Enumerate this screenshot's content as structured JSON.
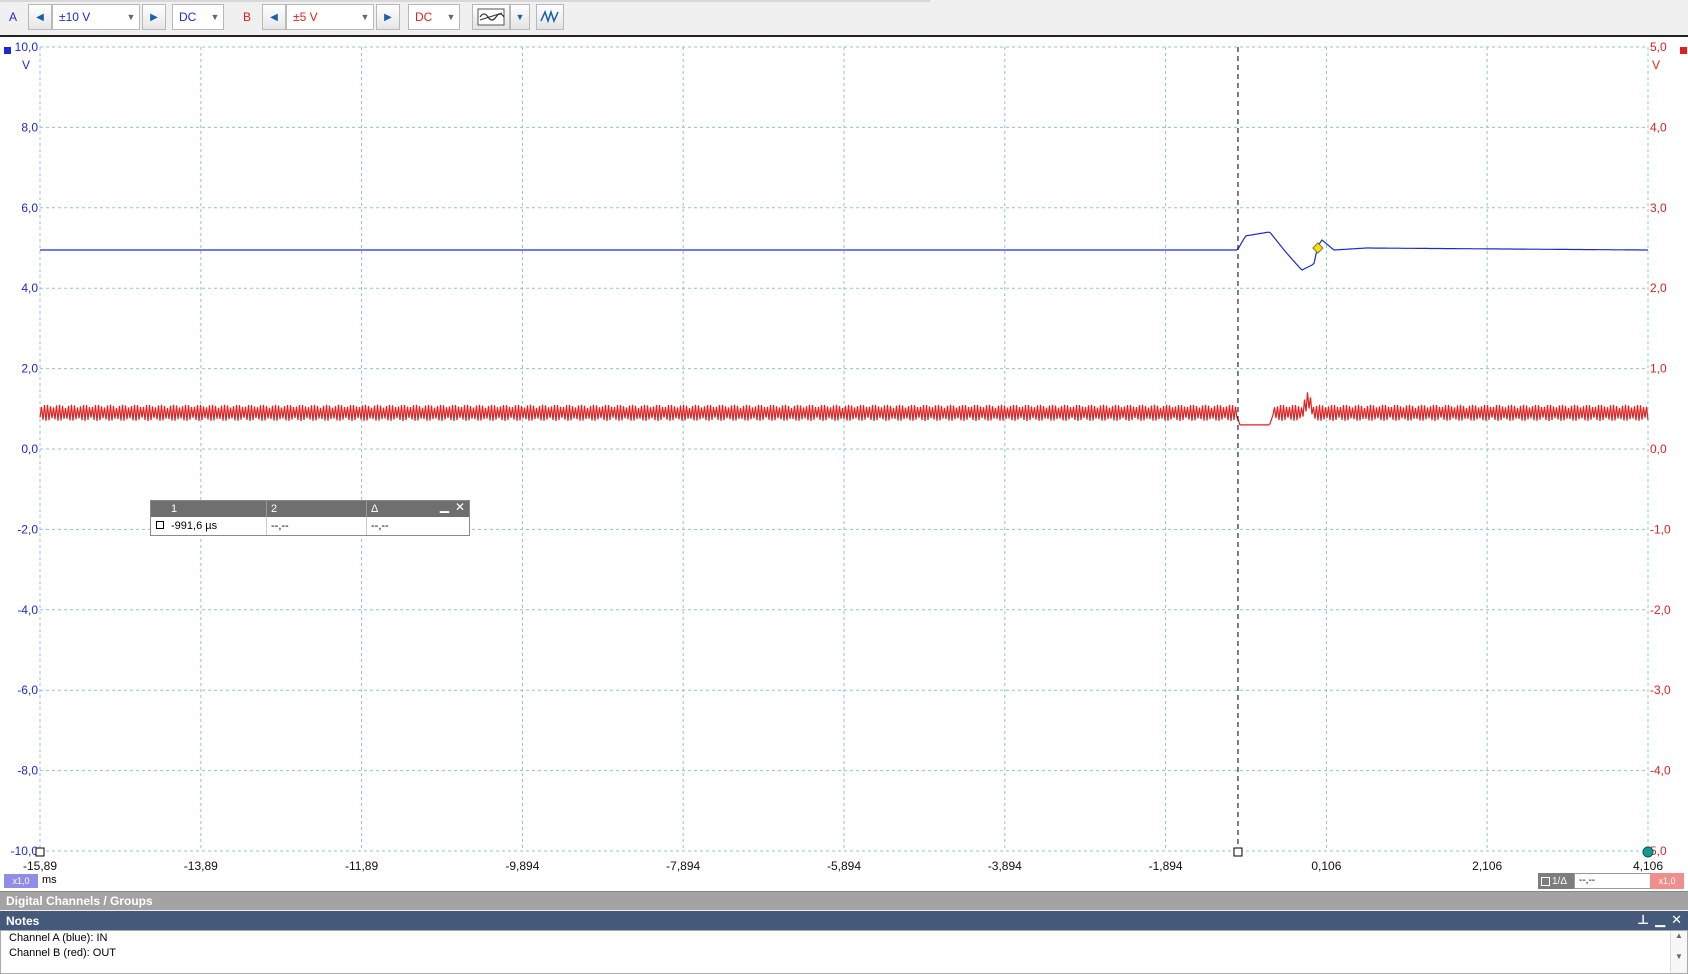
{
  "toolbar": {
    "channel_a": {
      "letter": "A",
      "range": "±10 V",
      "coupling": "DC",
      "color": "#1d2ad4"
    },
    "channel_b": {
      "letter": "B",
      "range": "±5 V",
      "coupling": "DC",
      "color": "#e01f1f"
    }
  },
  "chart_data": {
    "type": "line",
    "x_unit": "ms",
    "x_ticks": [
      "-15,89",
      "-13,89",
      "-11,89",
      "-9,894",
      "-7,894",
      "-5,894",
      "-3,894",
      "-1,894",
      "0,106",
      "2,106",
      "4,106"
    ],
    "xlim": [
      -15.894,
      4.106
    ],
    "y_left": {
      "unit": "V",
      "ticks": [
        "10,0",
        "8,0",
        "6,0",
        "4,0",
        "2,0",
        "0,0",
        "-2,0",
        "-4,0",
        "-6,0",
        "-8,0",
        "-10,0"
      ],
      "ylim": [
        -10,
        10
      ]
    },
    "y_right": {
      "unit": "V",
      "ticks": [
        "5,0",
        "4,0",
        "3,0",
        "2,0",
        "1,0",
        "0,0",
        "-1,0",
        "-2,0",
        "-3,0",
        "-4,0",
        "5,0"
      ],
      "ylim": [
        -5,
        5
      ]
    },
    "grid": true,
    "trigger_time_ms": -0.994,
    "series": [
      {
        "name": "A",
        "color": "#1d2ad4",
        "axis": "left",
        "x": [
          -15.894,
          -1.0,
          -0.9,
          -0.6,
          -0.4,
          -0.2,
          -0.05,
          0.0,
          0.05,
          0.2,
          0.6,
          4.106
        ],
        "y": [
          4.95,
          4.95,
          5.3,
          5.4,
          4.9,
          4.45,
          4.6,
          5.05,
          5.2,
          4.95,
          5.0,
          4.95
        ]
      },
      {
        "name": "B",
        "color": "#e01f1f",
        "axis": "left",
        "x": [
          -15.894,
          -1.0,
          -0.98,
          -0.6,
          -0.55,
          -0.2,
          -0.12,
          -0.05,
          0.0,
          4.106
        ],
        "y": [
          0.9,
          0.9,
          0.6,
          0.6,
          0.9,
          0.9,
          1.25,
          0.9,
          0.9,
          0.9
        ],
        "noise_amplitude": 0.2
      }
    ]
  },
  "measurements": {
    "headers": [
      "1",
      "2",
      "Δ"
    ],
    "values": [
      "-991,6 µs",
      "--,--",
      "--,--"
    ]
  },
  "bottom": {
    "zoom_a": "x1,0",
    "units": "ms",
    "ruler_label": "1/Δ",
    "ruler_value": "--,--",
    "zoom_b": "x1,0"
  },
  "digital_panel": {
    "title": "Digital Channels / Groups"
  },
  "notes": {
    "title": "Notes",
    "lines": [
      "Channel A (blue): IN",
      "Channel B (red): OUT"
    ]
  }
}
